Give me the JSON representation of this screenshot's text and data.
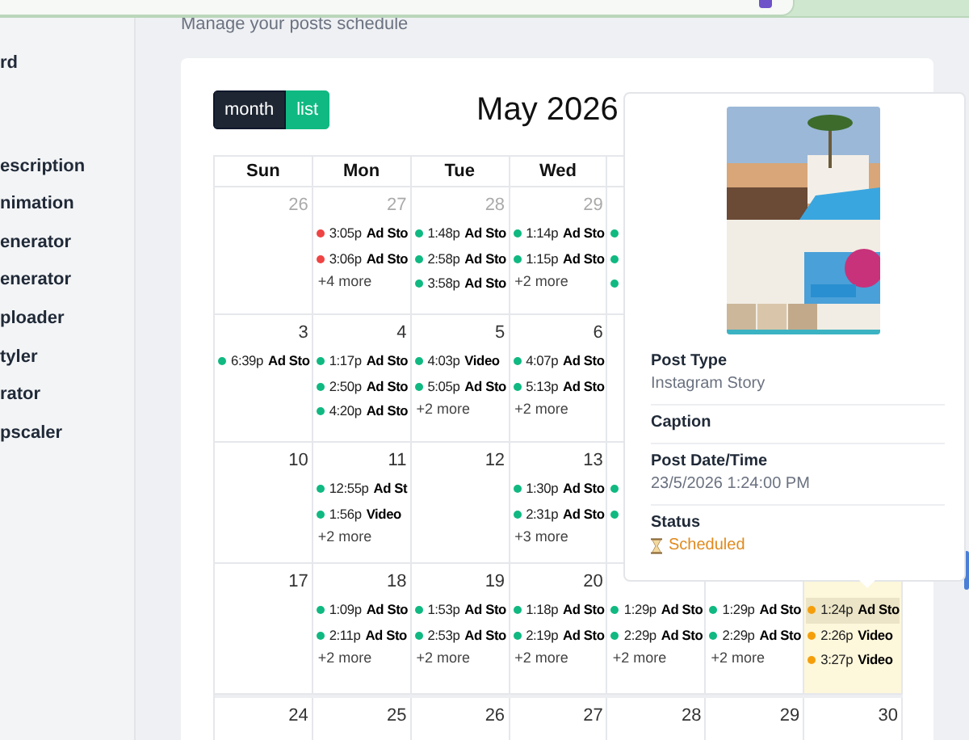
{
  "sidebar": {
    "items": [
      {
        "label": "rd"
      },
      {
        "label": "escription"
      },
      {
        "label": "nimation"
      },
      {
        "label": "enerator"
      },
      {
        "label": "enerator"
      },
      {
        "label": "ploader"
      },
      {
        "label": "tyler"
      },
      {
        "label": "rator"
      },
      {
        "label": "pscaler"
      }
    ]
  },
  "header": {
    "subtitle": "Manage your posts schedule"
  },
  "calendar": {
    "views": [
      {
        "label": "month",
        "selected": true
      },
      {
        "label": "list",
        "selected": false
      }
    ],
    "title": "May 2026",
    "weekdays": [
      "Sun",
      "Mon",
      "Tue",
      "Wed"
    ],
    "weeks": [
      [
        {
          "day": "26",
          "other_month": true
        },
        {
          "day": "27",
          "other_month": true,
          "events": [
            {
              "time": "3:05p",
              "title": "Ad Sto",
              "color": "#ef4444",
              "selected": false
            },
            {
              "time": "3:06p",
              "title": "Ad Sto",
              "color": "#ef4444",
              "selected": false
            }
          ],
          "more": "+4 more"
        },
        {
          "day": "28",
          "other_month": true,
          "events": [
            {
              "time": "1:48p",
              "title": "Ad Sto",
              "color": "#10b981",
              "selected": false
            },
            {
              "time": "2:58p",
              "title": "Ad Sto",
              "color": "#10b981",
              "selected": false
            },
            {
              "time": "3:58p",
              "title": "Ad Sto",
              "color": "#10b981",
              "selected": false
            }
          ]
        },
        {
          "day": "29",
          "other_month": true,
          "events": [
            {
              "time": "1:14p",
              "title": "Ad Sto",
              "color": "#10b981",
              "selected": false
            },
            {
              "time": "1:15p",
              "title": "Ad Sto",
              "color": "#10b981",
              "selected": false
            }
          ],
          "more": "+2 more"
        },
        {
          "events": [
            {
              "color": "#10b981"
            },
            {
              "color": "#10b981"
            },
            {
              "color": "#10b981"
            }
          ]
        }
      ],
      [
        {
          "day": "3",
          "other_month": false,
          "events": [
            {
              "time": "6:39p",
              "title": "Ad Sto",
              "color": "#10b981",
              "selected": false
            }
          ]
        },
        {
          "day": "4",
          "other_month": false,
          "events": [
            {
              "time": "1:17p",
              "title": "Ad Sto",
              "color": "#10b981",
              "selected": false
            },
            {
              "time": "2:50p",
              "title": "Ad Sto",
              "color": "#10b981",
              "selected": false
            },
            {
              "time": "4:20p",
              "title": "Ad Sto",
              "color": "#10b981",
              "selected": false
            }
          ]
        },
        {
          "day": "5",
          "other_month": false,
          "events": [
            {
              "time": "4:03p",
              "title": "Video",
              "color": "#10b981",
              "selected": false
            },
            {
              "time": "5:05p",
              "title": "Ad Sto",
              "color": "#10b981",
              "selected": false
            }
          ],
          "more": "+2 more"
        },
        {
          "day": "6",
          "other_month": false,
          "events": [
            {
              "time": "4:07p",
              "title": "Ad Sto",
              "color": "#10b981",
              "selected": false
            },
            {
              "time": "5:13p",
              "title": "Ad Sto",
              "color": "#10b981",
              "selected": false
            }
          ],
          "more": "+2 more"
        }
      ],
      [
        {
          "day": "10",
          "other_month": false
        },
        {
          "day": "11",
          "other_month": false,
          "events": [
            {
              "time": "12:55p",
              "title": "Ad St",
              "color": "#10b981",
              "selected": false
            },
            {
              "time": "1:56p",
              "title": "Video",
              "color": "#10b981",
              "selected": false
            }
          ],
          "more": "+2 more"
        },
        {
          "day": "12",
          "other_month": false
        },
        {
          "day": "13",
          "other_month": false,
          "events": [
            {
              "time": "1:30p",
              "title": "Ad Sto",
              "color": "#10b981",
              "selected": false
            },
            {
              "time": "2:31p",
              "title": "Ad Sto",
              "color": "#10b981",
              "selected": false
            }
          ],
          "more": "+3 more"
        },
        {
          "events": [
            {
              "color": "#10b981"
            },
            {
              "color": "#10b981"
            }
          ]
        }
      ],
      [
        {
          "day": "17",
          "other_month": false
        },
        {
          "day": "18",
          "other_month": false,
          "events": [
            {
              "time": "1:09p",
              "title": "Ad Sto",
              "color": "#10b981",
              "selected": false
            },
            {
              "time": "2:11p",
              "title": "Ad Sto",
              "color": "#10b981",
              "selected": false
            }
          ],
          "more": "+2 more"
        },
        {
          "day": "19",
          "other_month": false,
          "events": [
            {
              "time": "1:53p",
              "title": "Ad Sto",
              "color": "#10b981",
              "selected": false
            },
            {
              "time": "2:53p",
              "title": "Ad Sto",
              "color": "#10b981",
              "selected": false
            }
          ],
          "more": "+2 more"
        },
        {
          "day": "20",
          "other_month": false,
          "events": [
            {
              "time": "1:18p",
              "title": "Ad Sto",
              "color": "#10b981",
              "selected": false
            },
            {
              "time": "2:19p",
              "title": "Ad Sto",
              "color": "#10b981",
              "selected": false
            }
          ],
          "more": "+2 more"
        },
        {
          "events": [
            {
              "time": "1:29p",
              "title": "Ad Sto",
              "color": "#10b981",
              "selected": false
            },
            {
              "time": "2:29p",
              "title": "Ad Sto",
              "color": "#10b981",
              "selected": false
            }
          ],
          "more": "+2 more"
        },
        {
          "events": [
            {
              "time": "1:29p",
              "title": "Ad Sto",
              "color": "#10b981",
              "selected": false
            },
            {
              "time": "2:29p",
              "title": "Ad Sto",
              "color": "#10b981",
              "selected": false
            }
          ],
          "more": "+2 more"
        },
        {
          "today": true,
          "events": [
            {
              "time": "1:24p",
              "title": "Ad Sto",
              "color": "#f59e0b",
              "selected": true
            },
            {
              "time": "2:26p",
              "title": "Video",
              "color": "#f59e0b",
              "selected": false
            },
            {
              "time": "3:27p",
              "title": "Video",
              "color": "#f59e0b",
              "selected": false
            }
          ]
        }
      ],
      [
        {
          "day": "24",
          "other_month": false
        },
        {
          "day": "25",
          "other_month": false
        },
        {
          "day": "26",
          "other_month": false
        },
        {
          "day": "27",
          "other_month": false
        },
        {
          "day": "28",
          "other_month": false
        },
        {
          "day": "29",
          "other_month": false
        },
        {
          "day": "30",
          "other_month": false
        }
      ]
    ]
  },
  "popover": {
    "fields": [
      {
        "label": "Post Type",
        "value": "Instagram Story",
        "kind": "text"
      },
      {
        "label": "Caption"
      },
      {
        "label": "Post Date/Time",
        "value": "23/5/2026 1:24:00 PM",
        "kind": "text"
      },
      {
        "label": "Status",
        "value": "Scheduled",
        "kind": "status"
      }
    ]
  }
}
